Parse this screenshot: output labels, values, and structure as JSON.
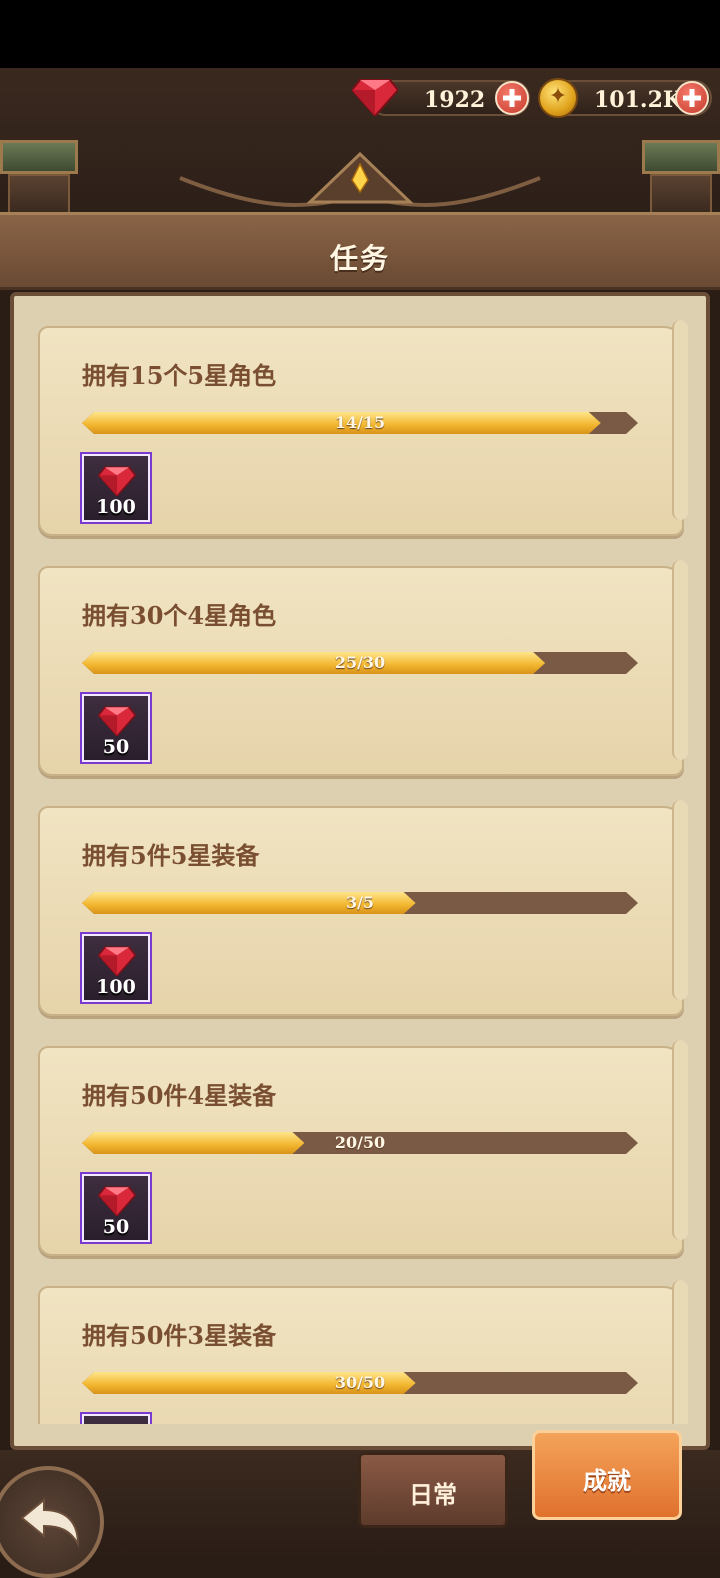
{
  "header": {
    "gems": "1922",
    "coins": "101.2K",
    "title": "任务"
  },
  "tasks": [
    {
      "title": "拥有15个5星角色",
      "progress_text": "14/15",
      "progress": 0.933,
      "reward_qty": "100",
      "reward_icon": "ruby-gem-icon"
    },
    {
      "title": "拥有30个4星角色",
      "progress_text": "25/30",
      "progress": 0.833,
      "reward_qty": "50",
      "reward_icon": "ruby-gem-icon"
    },
    {
      "title": "拥有5件5星装备",
      "progress_text": "3/5",
      "progress": 0.6,
      "reward_qty": "100",
      "reward_icon": "ruby-gem-icon"
    },
    {
      "title": "拥有50件4星装备",
      "progress_text": "20/50",
      "progress": 0.4,
      "reward_qty": "50",
      "reward_icon": "ruby-gem-icon"
    },
    {
      "title": "拥有50件3星装备",
      "progress_text": "30/50",
      "progress": 0.6,
      "reward_qty": "",
      "reward_icon": "ruby-gem-icon"
    }
  ],
  "tabs": {
    "daily": "日常",
    "achievement": "成就"
  },
  "colors": {
    "accent_orange": "#e0712d",
    "progress_gold": "#f2b52e",
    "title_brown": "#7a4e31"
  }
}
